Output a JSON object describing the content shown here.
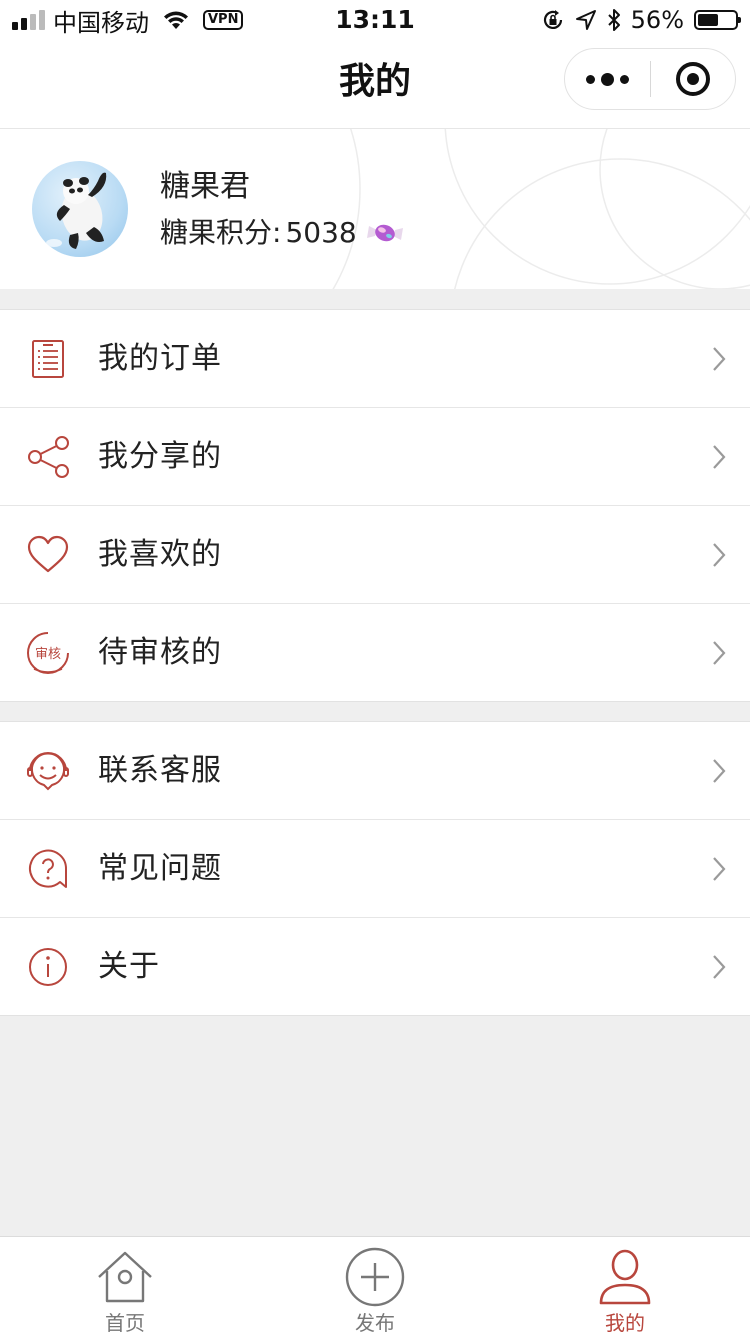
{
  "status_bar": {
    "carrier": "中国移动",
    "vpn": "VPN",
    "time": "13:11",
    "battery": "56%",
    "battery_level": 0.56
  },
  "nav": {
    "title": "我的"
  },
  "profile": {
    "name": "糖果君",
    "points_label": "糖果积分:",
    "points_value": "5038"
  },
  "menu": {
    "group1": [
      {
        "label": "我的订单",
        "icon": "order-list-icon"
      },
      {
        "label": "我分享的",
        "icon": "share-icon"
      },
      {
        "label": "我喜欢的",
        "icon": "heart-icon"
      },
      {
        "label": "待审核的",
        "icon": "review-stamp-icon",
        "icon_text": "审核"
      }
    ],
    "group2": [
      {
        "label": "联系客服",
        "icon": "customer-service-icon"
      },
      {
        "label": "常见问题",
        "icon": "question-icon"
      },
      {
        "label": "关于",
        "icon": "info-icon"
      }
    ]
  },
  "tabbar": {
    "tabs": [
      {
        "label": "首页",
        "icon": "home-icon",
        "active": false
      },
      {
        "label": "发布",
        "icon": "plus-circle-icon",
        "active": false
      },
      {
        "label": "我的",
        "icon": "user-icon",
        "active": true
      }
    ]
  },
  "colors": {
    "accent": "#b8463d",
    "background": "#efefef",
    "text": "#222222"
  }
}
